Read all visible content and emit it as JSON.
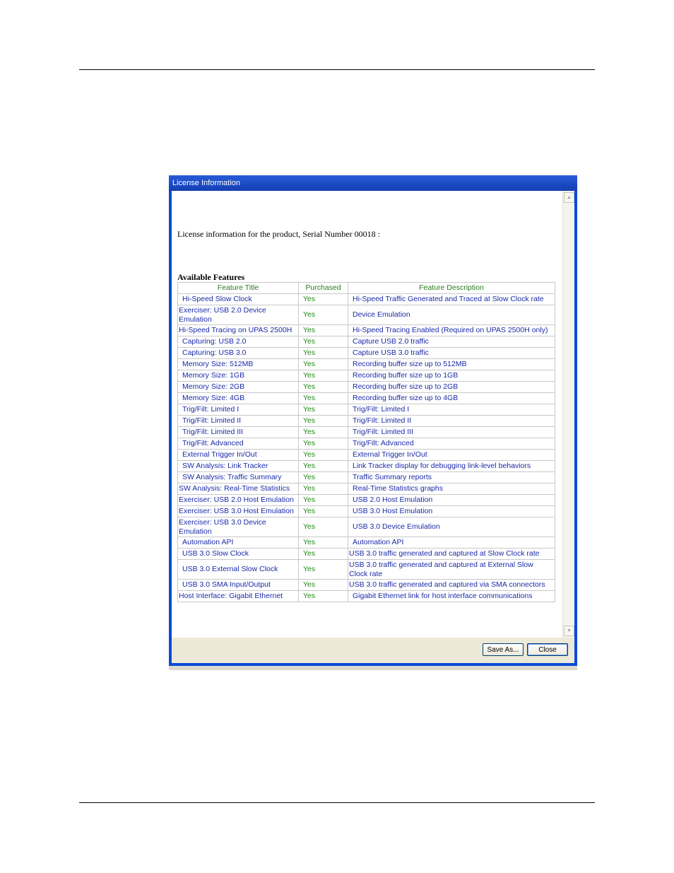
{
  "window": {
    "title": "License Information"
  },
  "intro_text": "License information for the product, Serial Number 00018 :",
  "section_title": "Available Features",
  "table": {
    "headers": [
      "Feature Title",
      "Purchased",
      "Feature Description"
    ],
    "rows": [
      [
        "Hi-Speed Slow Clock",
        "Yes",
        "Hi-Speed Traffic Generated and Traced at Slow Clock rate"
      ],
      [
        "Exerciser: USB 2.0 Device Emulation",
        "Yes",
        "Device Emulation"
      ],
      [
        "Hi-Speed Tracing on UPAS 2500H",
        "Yes",
        "Hi-Speed Tracing Enabled (Required on UPAS 2500H only)"
      ],
      [
        "Capturing: USB 2.0",
        "Yes",
        "Capture USB 2.0 traffic"
      ],
      [
        "Capturing: USB 3.0",
        "Yes",
        "Capture USB 3.0 traffic"
      ],
      [
        "Memory Size: 512MB",
        "Yes",
        "Recording buffer size up to 512MB"
      ],
      [
        "Memory Size: 1GB",
        "Yes",
        "Recording buffer size up to 1GB"
      ],
      [
        "Memory Size: 2GB",
        "Yes",
        "Recording buffer size up to 2GB"
      ],
      [
        "Memory Size: 4GB",
        "Yes",
        "Recording buffer size up to 4GB"
      ],
      [
        "Trig/Filt: Limited I",
        "Yes",
        "Trig/Filt: Limited I"
      ],
      [
        "Trig/Filt: Limited II",
        "Yes",
        "Trig/Filt: Limited II"
      ],
      [
        "Trig/Filt: Limited III",
        "Yes",
        "Trig/Filt: Limited III"
      ],
      [
        "Trig/Filt: Advanced",
        "Yes",
        "Trig/Filt: Advanced"
      ],
      [
        "External Trigger In/Out",
        "Yes",
        "External Trigger In/Out"
      ],
      [
        "SW Analysis: Link Tracker",
        "Yes",
        "Link Tracker display for debugging link-level behaviors"
      ],
      [
        "SW Analysis: Traffic Summary",
        "Yes",
        "Traffic Summary reports"
      ],
      [
        "SW Analysis: Real-Time Statistics",
        "Yes",
        "Real-Time Statistics graphs"
      ],
      [
        "Exerciser: USB 2.0 Host Emulation",
        "Yes",
        "USB 2.0 Host Emulation"
      ],
      [
        "Exerciser: USB 3.0 Host Emulation",
        "Yes",
        "USB 3.0 Host Emulation"
      ],
      [
        "Exerciser: USB 3.0 Device Emulation",
        "Yes",
        "USB 3.0 Device Emulation"
      ],
      [
        "Automation API",
        "Yes",
        "Automation API"
      ],
      [
        "USB 3.0 Slow Clock",
        "Yes",
        "USB 3.0 traffic generated and captured at Slow Clock rate"
      ],
      [
        "USB 3.0 External Slow Clock",
        "Yes",
        "USB 3.0 traffic generated and captured at External Slow Clock rate"
      ],
      [
        "USB 3.0 SMA Input/Output",
        "Yes",
        "USB 3.0 traffic generated and captured via SMA connectors"
      ],
      [
        "Host Interface: Gigabit Ethernet",
        "Yes",
        "Gigabit Ethernet link for host interface communications"
      ]
    ]
  },
  "buttons": {
    "save_as": "Save As...",
    "close": "Close"
  },
  "icons": {
    "scroll_up": "scroll-up-arrow-icon",
    "scroll_down": "scroll-down-arrow-icon"
  },
  "colors": {
    "title_bar": "#1a49c3",
    "header_text": "#2a7a1e",
    "feature_text": "#1a2aa8",
    "purchased_text": "#1f8a17"
  }
}
